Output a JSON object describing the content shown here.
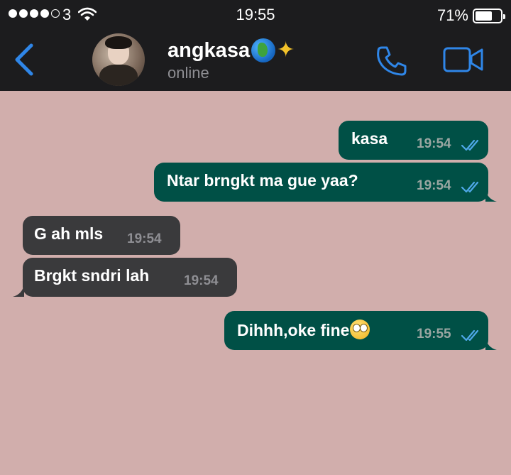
{
  "status_bar": {
    "carrier": "3",
    "time": "19:55",
    "battery_percent": "71%",
    "battery_level": 0.71,
    "signal_bars": 4
  },
  "header": {
    "back_icon": "chevron-left-icon",
    "contact_name": "angkasa",
    "contact_status": "online",
    "call_icon": "phone-icon",
    "video_icon": "video-camera-icon",
    "accent_color": "#2f86e8"
  },
  "messages": [
    {
      "direction": "out",
      "text": "kasa",
      "time": "19:54",
      "read": true
    },
    {
      "direction": "out",
      "text": "Ntar brngkt ma gue yaa?",
      "time": "19:54",
      "read": true
    },
    {
      "direction": "in",
      "text": "G ah mls",
      "time": "19:54"
    },
    {
      "direction": "in",
      "text": "Brgkt sndri lah",
      "time": "19:54"
    },
    {
      "direction": "out",
      "text": "Dihhh,oke fine",
      "time": "19:55",
      "read": true
    }
  ],
  "colors": {
    "chat_background": "#d1aeac",
    "outgoing_bubble": "#005046",
    "incoming_bubble": "#3a3a3c",
    "read_ticks": "#4fa8e8"
  }
}
